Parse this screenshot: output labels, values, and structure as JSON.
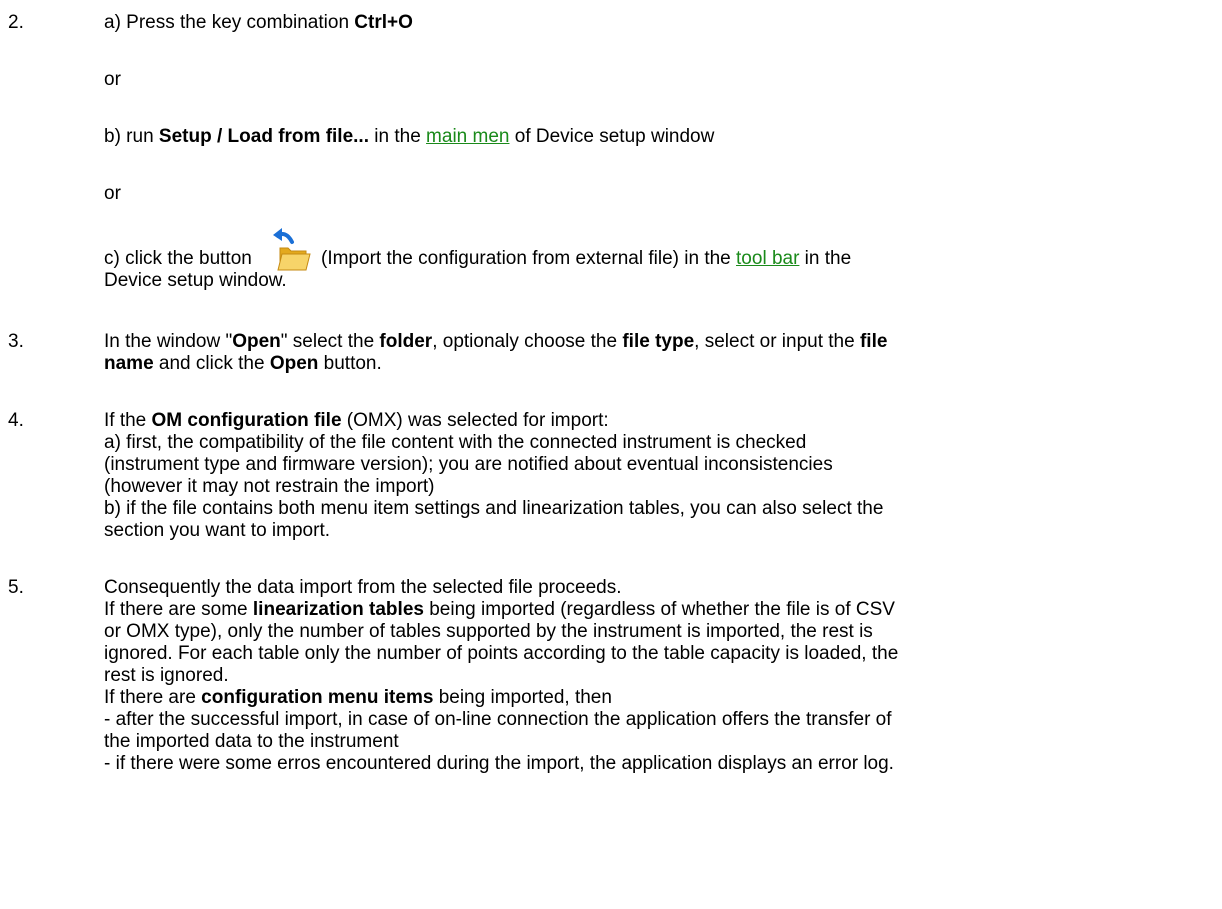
{
  "step2": {
    "number": "2.",
    "a_prefix": "a) Press the key combination ",
    "a_key": "Ctrl+O",
    "or1": "or",
    "b_prefix": "b) run ",
    "b_cmd": "Setup / Load from file...",
    "b_mid": " in the ",
    "b_link": "main men",
    "b_suffix": " of Device setup window",
    "or2": "or",
    "c_prefix": "c) click the button",
    "c_icon": "import-folder-icon",
    "c_mid": "(Import the configuration from external file) in the ",
    "c_link": "tool bar",
    "c_suffix": " in the",
    "c_line2": "Device setup window."
  },
  "step3": {
    "number": "3.",
    "t1": "In the window \"",
    "open_word": "Open",
    "t2": "\" select the ",
    "folder": "folder",
    "t3": ", optionaly choose the ",
    "file_type": "file type",
    "t4": ", select or input the ",
    "file_word": "file",
    "name_word": "name",
    "t5": " and click the ",
    "open_btn": "Open",
    "t6": " button."
  },
  "step4": {
    "number": "4.",
    "t1": "If the ",
    "omfile": "OM configuration file",
    "t2": " (OMX) was selected for import:",
    "l2": "a) first, the compatibility of the file content with the connected instrument is checked",
    "l3": "(instrument type and firmware version); you are notified about eventual inconsistencies",
    "l4": "(however it may not restrain the import)",
    "l5": "b) if the file contains both menu item settings and linearization tables, you can also select the",
    "l6": "section you want to import."
  },
  "step5": {
    "number": "5.",
    "l1": "Consequently the data import from the selected file proceeds.",
    "l2a": "If there are some ",
    "lin_tables": "linearization tables",
    "l2b": " being imported (regardless of whether the file is of CSV",
    "l3": "or OMX type), only the  number of tables supported by the instrument is imported, the rest is",
    "l4": "ignored. For each table only the number of points according to the table capacity is loaded, the",
    "l5": "rest is ignored.",
    "l6a": "If there are ",
    "cfg_items": "configuration menu items",
    "l6b": " being imported, then",
    "l7": "- after the successful import, in case of on-line connection the application offers the transfer of",
    "l8": "the imported data to the instrument",
    "l9": "- if there were some erros encountered during the import, the application displays an error log."
  },
  "colors": {
    "link": "#1a8a1a",
    "text": "#000000",
    "icon_arrow": "#1a6fd6",
    "icon_folder": "#f2c23a"
  }
}
